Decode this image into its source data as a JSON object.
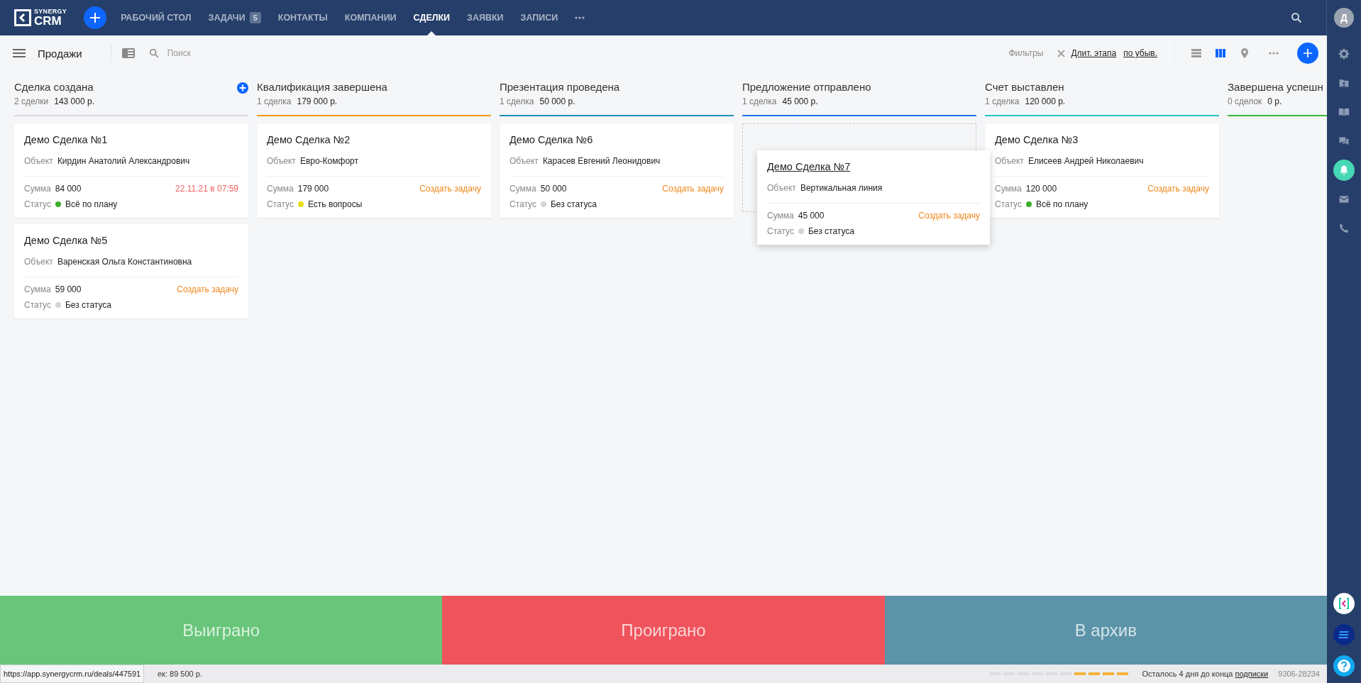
{
  "logo": {
    "line1": "SYNERGY",
    "line2": "CRM"
  },
  "nav": [
    {
      "label": "РАБОЧИЙ СТОЛ",
      "selected": false
    },
    {
      "label": "ЗАДАЧИ",
      "badge": "5",
      "selected": false
    },
    {
      "label": "КОНТАКТЫ",
      "selected": false
    },
    {
      "label": "КОМПАНИИ",
      "selected": false
    },
    {
      "label": "СДЕЛКИ",
      "selected": true
    },
    {
      "label": "ЗАЯВКИ",
      "selected": false
    },
    {
      "label": "ЗАПИСИ",
      "selected": false
    }
  ],
  "user": {
    "initial": "Д"
  },
  "toolbar": {
    "title": "Продажи",
    "search_placeholder": "Поиск",
    "filters_label": "Фильтры",
    "sort_field": "Длит. этапа",
    "sort_order": "по убыв.",
    "views": [
      {
        "kind": "list",
        "selected": false
      },
      {
        "kind": "kanban",
        "selected": true
      },
      {
        "kind": "map",
        "selected": false
      }
    ]
  },
  "columns": [
    {
      "title": "Сделка создана",
      "count": "2 сделки",
      "sum": "143 000 р.",
      "color": "#d6d8dc",
      "add_button": true,
      "cards": [
        {
          "title": "Демо Сделка №1",
          "object_label": "Объект",
          "object": "Кирдин Анатолий Александрович",
          "sum_label": "Сумма",
          "sum": "84 000",
          "action": {
            "kind": "due",
            "text": "22.11.21 в 07:59"
          },
          "status": {
            "label": "Статус",
            "text": "Всё по плану",
            "color": "#3cae2c"
          },
          "dragging": false
        },
        {
          "title": "Демо Сделка №5",
          "object_label": "Объект",
          "object": "Варенская Ольга Константиновна",
          "sum_label": "Сумма",
          "sum": "59 000",
          "action": {
            "kind": "task",
            "text": "Создать задачу"
          },
          "status": {
            "label": "Статус",
            "text": "Без статуса",
            "color": "#d4d4d4"
          },
          "dragging": false
        }
      ]
    },
    {
      "title": "Квалификация завершена",
      "count": "1 сделка",
      "sum": "179 000 р.",
      "color": "#f39a12",
      "add_button": false,
      "cards": [
        {
          "title": "Демо Сделка №2",
          "object_label": "Объект",
          "object": "Евро-Комфорт",
          "sum_label": "Сумма",
          "sum": "179 000",
          "action": {
            "kind": "task",
            "text": "Создать задачу"
          },
          "status": {
            "label": "Статус",
            "text": "Есть вопросы",
            "color": "#e6dc12"
          },
          "dragging": false
        }
      ]
    },
    {
      "title": "Презентация проведена",
      "count": "1 сделка",
      "sum": "50 000 р.",
      "color": "#1b8fb8",
      "add_button": false,
      "cards": [
        {
          "title": "Демо Сделка №6",
          "object_label": "Объект",
          "object": "Карасев Евгений Леонидович",
          "sum_label": "Сумма",
          "sum": "50 000",
          "action": {
            "kind": "task",
            "text": "Создать задачу"
          },
          "status": {
            "label": "Статус",
            "text": "Без статуса",
            "color": "#d4d4d4"
          },
          "dragging": false
        }
      ]
    },
    {
      "title": "Предложение отправлено",
      "count": "1 сделка",
      "sum": "45 000 р.",
      "color": "#2470f0",
      "add_button": false,
      "cards": [
        {
          "title": "Демо Сделка №7",
          "object_label": "Объект",
          "object": "Вертикальная линия",
          "sum_label": "Сумма",
          "sum": "45 000",
          "action": {
            "kind": "task",
            "text": "Создать задачу"
          },
          "status": {
            "label": "Статус",
            "text": "Без статуса",
            "color": "#d4d4d4"
          },
          "dragging": true
        }
      ]
    },
    {
      "title": "Счет выставлен",
      "count": "1 сделка",
      "sum": "120 000 р.",
      "color": "#22c6c8",
      "add_button": false,
      "cards": [
        {
          "title": "Демо Сделка №3",
          "object_label": "Объект",
          "object": "Елисеев Андрей Николаевич",
          "sum_label": "Сумма",
          "sum": "120 000",
          "action": {
            "kind": "task",
            "text": "Создать задачу"
          },
          "status": {
            "label": "Статус",
            "text": "Всё по плану",
            "color": "#3cae2c"
          },
          "dragging": false
        }
      ]
    },
    {
      "title": "Завершена успешн",
      "count": "0 сделок",
      "sum": "0 р.",
      "color": "#3cb83c",
      "add_button": false
    }
  ],
  "drop_zones": [
    {
      "label": "Выиграно",
      "color": "#68c57a"
    },
    {
      "label": "Проиграно",
      "color": "#ef535c"
    },
    {
      "label": "В архив",
      "color": "#5b93a8"
    }
  ],
  "status_bar": {
    "link_tooltip": "https://app.synergycrm.ru/deals/447591",
    "total": "ек: 89 500 р.",
    "trial_text": "Осталось 4 дня до конца",
    "trial_link": "подписки",
    "account": "9306-28234",
    "trial_progress": {
      "level": 0.4
    }
  },
  "sidebar": [
    {
      "kind": "settings",
      "selected": false
    },
    {
      "kind": "folder",
      "selected": false
    },
    {
      "kind": "book",
      "selected": false
    },
    {
      "kind": "chat",
      "selected": false
    },
    {
      "kind": "bell",
      "selected": true
    },
    {
      "kind": "mail",
      "selected": false
    },
    {
      "kind": "phone",
      "selected": false
    }
  ]
}
